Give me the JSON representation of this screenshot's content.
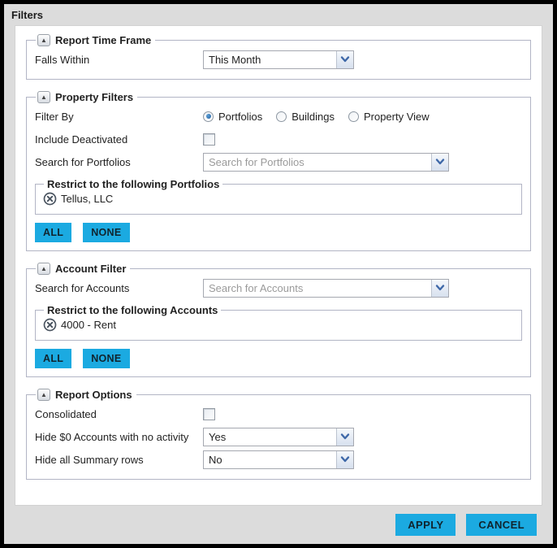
{
  "dialog": {
    "title": "Filters"
  },
  "colors": {
    "accent_cyan": "#1baae1",
    "chrome_gray": "#dcdcdc",
    "fieldset_border": "#b2b5c5",
    "chevron_blue": "#3e68a8",
    "remove_icon": "#4a5460"
  },
  "icons": {
    "collapse_glyph": "▲"
  },
  "sections": {
    "report_time_frame": {
      "legend": "Report Time Frame",
      "falls_within": {
        "label": "Falls Within",
        "value": "This Month"
      }
    },
    "property_filters": {
      "legend": "Property Filters",
      "filter_by": {
        "label": "Filter By",
        "options": [
          {
            "label": "Portfolios",
            "selected": true
          },
          {
            "label": "Buildings",
            "selected": false
          },
          {
            "label": "Property View",
            "selected": false
          }
        ]
      },
      "include_deactivated": {
        "label": "Include Deactivated",
        "checked": false
      },
      "search": {
        "label": "Search for Portfolios",
        "placeholder": "Search for Portfolios"
      },
      "restrict": {
        "legend": "Restrict to the following Portfolios",
        "items": [
          "Tellus, LLC"
        ]
      },
      "all_label": "ALL",
      "none_label": "NONE"
    },
    "account_filter": {
      "legend": "Account Filter",
      "search": {
        "label": "Search for Accounts",
        "placeholder": "Search for Accounts"
      },
      "restrict": {
        "legend": "Restrict to the following Accounts",
        "items": [
          "4000 - Rent"
        ]
      },
      "all_label": "ALL",
      "none_label": "NONE"
    },
    "report_options": {
      "legend": "Report Options",
      "consolidated": {
        "label": "Consolidated",
        "checked": false
      },
      "hide_zero_accounts": {
        "label": "Hide $0 Accounts with no activity",
        "value": "Yes"
      },
      "hide_summary_rows": {
        "label": "Hide all Summary rows",
        "value": "No"
      }
    }
  },
  "footer": {
    "apply_label": "APPLY",
    "cancel_label": "CANCEL"
  }
}
